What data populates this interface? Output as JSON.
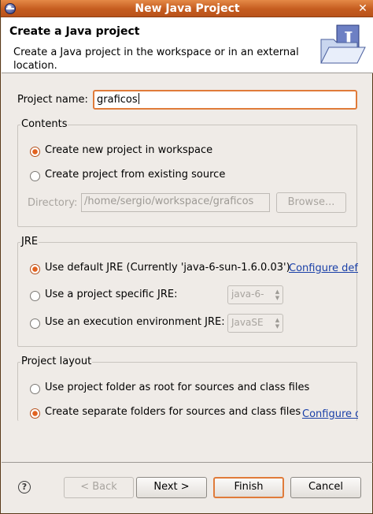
{
  "window": {
    "title": "New Java Project",
    "close_glyph": "✕"
  },
  "banner": {
    "title": "Create a Java project",
    "message": "Create a Java project in the workspace or in an external location."
  },
  "project_name": {
    "label": "Project name:",
    "value": "graficos"
  },
  "contents": {
    "title": "Contents",
    "options": [
      "Create new project in workspace",
      "Create project from existing source"
    ],
    "selected": 0,
    "directory_label": "Directory:",
    "directory_value": "/home/sergio/workspace/graficos",
    "browse_label": "Browse..."
  },
  "jre": {
    "title": "JRE",
    "options": [
      "Use default JRE (Currently 'java-6-sun-1.6.0.03')",
      "Use a project specific JRE:",
      "Use an execution environment JRE:"
    ],
    "selected": 0,
    "configure_link": "Configure defa",
    "project_jre_value": "java-6-",
    "exec_env_value": "JavaSE"
  },
  "layout": {
    "title": "Project layout",
    "options": [
      "Use project folder as root for sources and class files",
      "Create separate folders for sources and class files"
    ],
    "selected": 1,
    "configure_link": "Configure d"
  },
  "footer": {
    "help_glyph": "?",
    "back_label": "< Back",
    "next_label": "Next >",
    "finish_label": "Finish",
    "cancel_label": "Cancel"
  },
  "icons": {
    "window_menu": "window-menu-icon",
    "close": "close-icon",
    "banner": "java-project-folder-icon",
    "help": "help-icon"
  },
  "colors": {
    "title_bar": "#c55c1f",
    "focus": "#e07b3a",
    "link": "#1a40a8"
  }
}
